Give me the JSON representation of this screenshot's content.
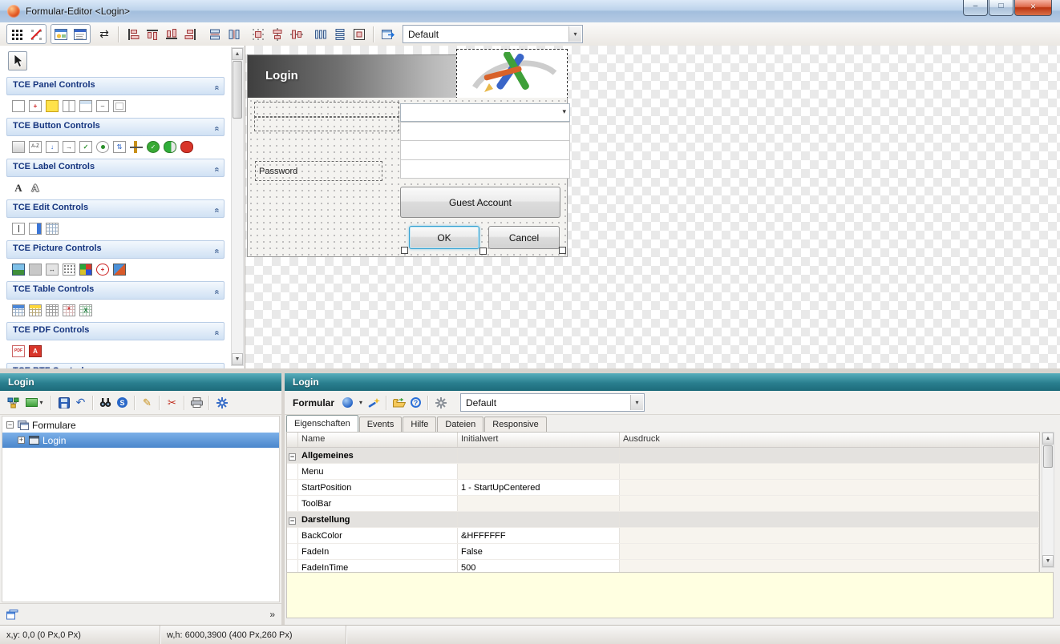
{
  "glyphs": {
    "chevron_double": "»",
    "dropdown": "▾",
    "minus": "−",
    "plus": "+",
    "minimize": "–",
    "maximize": "□",
    "close": "×",
    "swap": "⇄",
    "undo": "↶",
    "updown": "⇅",
    "check": "✓",
    "scissors": "✂",
    "pencil": "✎",
    "arrow_right": "→",
    "arrow_down": "↓",
    "left_right": "↔",
    "star": "*",
    "x_letter": "X",
    "s_badge": "S",
    "question": "?"
  },
  "titlebar": {
    "title": "Formular-Editor <Login>"
  },
  "main_toolbar": {
    "preset_combo": "Default"
  },
  "toolbox": {
    "sections": [
      {
        "title": "TCE Panel Controls"
      },
      {
        "title": "TCE Button Controls"
      },
      {
        "title": "TCE Label Controls"
      },
      {
        "title": "TCE Edit Controls"
      },
      {
        "title": "TCE Picture Controls"
      },
      {
        "title": "TCE Table Controls"
      },
      {
        "title": "TCE PDF Controls"
      },
      {
        "title": "TCE RTF Controls"
      }
    ],
    "button_az_label": "A-Z",
    "label_letter": "A",
    "pdf_label": "PDF"
  },
  "designer": {
    "form_title": "Login",
    "password_label": "Password",
    "guest_button": "Guest Account",
    "ok_button": "OK",
    "cancel_button": "Cancel"
  },
  "forms_panel": {
    "title": "Login",
    "tree": {
      "root_label": "Formulare",
      "child_label": "Login"
    },
    "more_hint": "»"
  },
  "properties_panel": {
    "title": "Login",
    "toolbar_label": "Formular",
    "preset_combo": "Default",
    "tabs": [
      "Eigenschaften",
      "Events",
      "Hilfe",
      "Dateien",
      "Responsive"
    ],
    "columns": [
      "Name",
      "Initialwert",
      "Ausdruck"
    ],
    "rows": [
      {
        "type": "group",
        "name": "Allgemeines"
      },
      {
        "type": "prop",
        "name": "Menu",
        "value": "",
        "expr": ""
      },
      {
        "type": "prop",
        "name": "StartPosition",
        "value": "1 - StartUpCentered",
        "expr": ""
      },
      {
        "type": "prop",
        "name": "ToolBar",
        "value": "",
        "expr": ""
      },
      {
        "type": "group",
        "name": "Darstellung"
      },
      {
        "type": "prop",
        "name": "BackColor",
        "value": "&HFFFFFF",
        "expr": ""
      },
      {
        "type": "prop",
        "name": "FadeIn",
        "value": "False",
        "expr": ""
      },
      {
        "type": "prop",
        "name": "FadeInTime",
        "value": "500",
        "expr": ""
      }
    ]
  },
  "statusbar": {
    "position_text": "x,y: 0,0 (0 Px,0 Px)",
    "size_text": "w,h: 6000,3900 (400 Px,260 Px)"
  },
  "colors": {
    "panel_header_teal_top": "#58aebc",
    "panel_header_teal_bottom": "#1d6b7a",
    "selection_blue": "#4a86cc",
    "close_button_red": "#bb3410",
    "help_area_yellow": "#ffffe1",
    "section_header_text": "#16357f"
  }
}
